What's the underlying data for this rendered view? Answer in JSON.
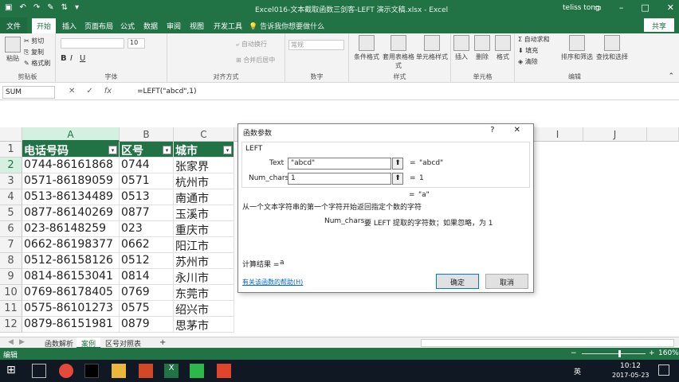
{
  "title_bar": {
    "title": "Excel016-文本截取函数三剑客-LEFT 演示文稿.xlsx - Excel",
    "user": "teliss tong",
    "qa_icons": [
      "save-icon",
      "undo-icon",
      "redo-icon",
      "brush-icon",
      "sort-icon",
      "more-icon"
    ]
  },
  "ribbon_tabs": [
    "文件",
    "开始",
    "插入",
    "页面布局",
    "公式",
    "数据",
    "审阅",
    "视图",
    "开发工具"
  ],
  "tell_me": "告诉我你想要做什么",
  "share": "共享",
  "ribbon": {
    "clipboard": {
      "paste": "粘贴",
      "cut": "剪切",
      "copy": "复制",
      "format_painter": "格式刷",
      "label": "剪贴板"
    },
    "font": {
      "size": "10",
      "bold": "B",
      "italic": "I",
      "underline": "U",
      "label": "字体"
    },
    "alignment": {
      "wrap": "自动换行",
      "merge": "合并后居中",
      "label": "对齐方式"
    },
    "number": {
      "format": "常规",
      "label": "数字"
    },
    "styles": {
      "conditional": "条件格式",
      "table_format": "套用表格格式",
      "cell_styles": "单元格样式",
      "label": "样式"
    },
    "cells": {
      "insert": "插入",
      "delete": "删除",
      "format": "格式",
      "label": "单元格"
    },
    "editing": {
      "autosum": "自动求和",
      "fill": "填充",
      "clear": "清除",
      "sort_filter": "排序和筛选",
      "find_select": "查找和选择",
      "label": "编辑"
    }
  },
  "formula_bar": {
    "name_box": "SUM",
    "cancel": "✕",
    "enter": "✓",
    "fx": "fx",
    "formula": "=LEFT(\"abcd\",1)"
  },
  "columns": [
    "A",
    "B",
    "C",
    "",
    "",
    "",
    "",
    "",
    "",
    "I",
    "J"
  ],
  "headers": {
    "a": "电话号码",
    "b": "区号",
    "c": "城市"
  },
  "rows": [
    {
      "n": "1"
    },
    {
      "n": "2",
      "phone": "0744-86161868",
      "code": "0744",
      "city": "张家界"
    },
    {
      "n": "3",
      "phone": "0571-86189059",
      "code": "0571",
      "city": "杭州市"
    },
    {
      "n": "4",
      "phone": "0513-86134489",
      "code": "0513",
      "city": "南通市"
    },
    {
      "n": "5",
      "phone": "0877-86140269",
      "code": "0877",
      "city": "玉溪市"
    },
    {
      "n": "6",
      "phone": "023-86148259",
      "code": "023",
      "city": "重庆市"
    },
    {
      "n": "7",
      "phone": "0662-86198377",
      "code": "0662",
      "city": "阳江市"
    },
    {
      "n": "8",
      "phone": "0512-86158126",
      "code": "0512",
      "city": "苏州市"
    },
    {
      "n": "9",
      "phone": "0814-86153041",
      "code": "0814",
      "city": "永川市"
    },
    {
      "n": "10",
      "phone": "0769-86178405",
      "code": "0769",
      "city": "东莞市"
    },
    {
      "n": "11",
      "phone": "0575-86101273",
      "code": "0575",
      "city": "绍兴市"
    },
    {
      "n": "12",
      "phone": "0879-86151981",
      "code": "0879",
      "city": "思茅市"
    }
  ],
  "dialog": {
    "title": "函数参数",
    "help": "?",
    "close": "✕",
    "function_name": "LEFT",
    "arg1_label": "Text",
    "arg1_value": "\"abcd\"",
    "arg1_result": "\"abcd\"",
    "arg2_label": "Num_chars",
    "arg2_value": "1",
    "arg2_result": "1",
    "eq": "=",
    "result_preview": "\"a\"",
    "description": "从一个文本字符串的第一个字符开始返回指定个数的字符",
    "arg_help_name": "Num_chars",
    "arg_help": "要 LEFT 提取的字符数；如果忽略，为 1",
    "calc_label": "计算结果 =",
    "calc_value": "a",
    "help_link": "有关该函数的帮助(H)",
    "ok": "确定",
    "cancel": "取消"
  },
  "sheet_tabs": [
    "函数解析",
    "案例",
    "区号对照表"
  ],
  "add_sheet": "+",
  "status": {
    "mode": "编辑",
    "zoom": "160%"
  },
  "taskbar": {
    "time": "10:12",
    "date": "2017-05-23",
    "lang": "英"
  }
}
